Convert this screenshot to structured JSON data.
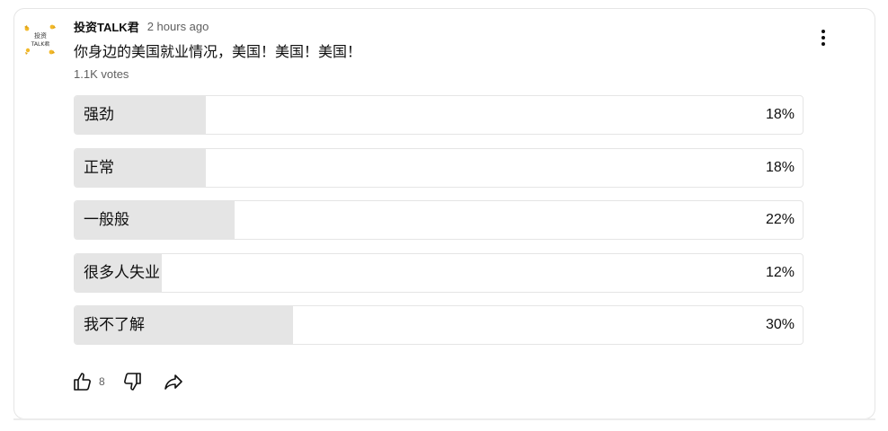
{
  "post": {
    "author": "投资TALK君",
    "time": "2 hours ago",
    "text": "你身边的美国就业情况，美国！美国！美国！",
    "votes": "1.1K votes",
    "avatar_text_line1": "投资",
    "avatar_text_line2": "TALK君"
  },
  "poll": {
    "options": [
      {
        "label": "强劲",
        "percent": "18%",
        "fraction": 0.18
      },
      {
        "label": "正常",
        "percent": "18%",
        "fraction": 0.18
      },
      {
        "label": "一般般",
        "percent": "22%",
        "fraction": 0.22
      },
      {
        "label": "很多人失业",
        "percent": "12%",
        "fraction": 0.12
      },
      {
        "label": "我不了解",
        "percent": "30%",
        "fraction": 0.3
      }
    ]
  },
  "actions": {
    "like_count": "8",
    "icons": [
      "thumbs-up-icon",
      "thumbs-down-icon",
      "share-icon",
      "more-vert-icon"
    ]
  },
  "colors": {
    "fill": "#e5e5e5",
    "text": "#0f0f0f",
    "secondary_text": "#606060"
  }
}
